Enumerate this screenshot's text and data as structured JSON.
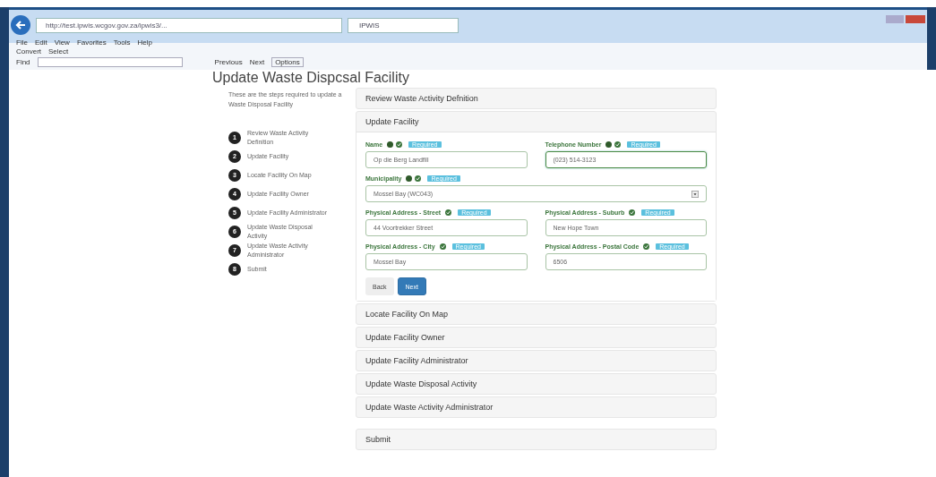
{
  "browser": {
    "url": "http://test.ipwis.wcgov.gov.za/ipwis3/...",
    "tab_title": "IPWIS",
    "menu": [
      "File",
      "Edit",
      "View",
      "Favorites",
      "Tools",
      "Help"
    ],
    "toolbar": {
      "convert": "Convert",
      "select": "Select"
    },
    "find_bar": {
      "label": "Find",
      "previous": "Previous",
      "next": "Next",
      "options": "Options"
    }
  },
  "page": {
    "title": "Update Waste Dispcsal Facility",
    "intro": "These are the steps required to update a Waste Disposal Facility",
    "steps": [
      {
        "number": "1",
        "label": "Review Waste Activity Definition"
      },
      {
        "number": "2",
        "label": "Update Facility"
      },
      {
        "number": "3",
        "label": "Locate Facility On Map"
      },
      {
        "number": "4",
        "label": "Update Facility Owner"
      },
      {
        "number": "5",
        "label": "Update Facility Administrator"
      },
      {
        "number": "6",
        "label": "Update Waste Disposal Activity"
      },
      {
        "number": "7",
        "label": "Update Waste Activity Administrator"
      },
      {
        "number": "8",
        "label": "Submit"
      }
    ],
    "sections": [
      {
        "title": "Review Waste Activity Defnition",
        "expanded": false
      },
      {
        "title": "Update Facility",
        "expanded": true
      },
      {
        "title": "Locate Facility On Map",
        "expanded": false
      },
      {
        "title": "Update Facility Owner",
        "expanded": false
      },
      {
        "title": "Update Facility Administrator",
        "expanded": false
      },
      {
        "title": "Update Waste Disposal Activity",
        "expanded": false
      },
      {
        "title": "Update Waste Activity Administrator",
        "expanded": false
      },
      {
        "title": "Submit",
        "expanded": false
      }
    ],
    "fields": [
      {
        "kind": "text",
        "label": "Name",
        "help": true,
        "badge": "Required",
        "value": "Op die Berg Landfill",
        "focused": false
      },
      {
        "kind": "text",
        "label": "Telephone Number",
        "help": true,
        "badge": "Required",
        "value": "(023) 514-3123",
        "focused": true
      },
      {
        "kind": "select",
        "label": "Municipality",
        "help": true,
        "badge": "Required",
        "value": "Mossel Bay (WC043)",
        "focused": false
      },
      {
        "kind": "text",
        "label": "Physical Address - Street",
        "help": false,
        "badge": "Required",
        "value": "44 Voortrekker Street",
        "focused": false
      },
      {
        "kind": "text",
        "label": "Physical Address - Suburb",
        "help": false,
        "badge": "Required",
        "value": "New Hope Town",
        "focused": false
      },
      {
        "kind": "text",
        "label": "Physical Address - City",
        "help": false,
        "badge": "Required",
        "value": "Mossel Bay",
        "focused": false
      },
      {
        "kind": "text",
        "label": "Physical Address - Postal Code",
        "help": false,
        "badge": "Required",
        "value": "6506",
        "focused": false
      }
    ],
    "buttons": {
      "back": "Back",
      "next": "Next"
    }
  }
}
